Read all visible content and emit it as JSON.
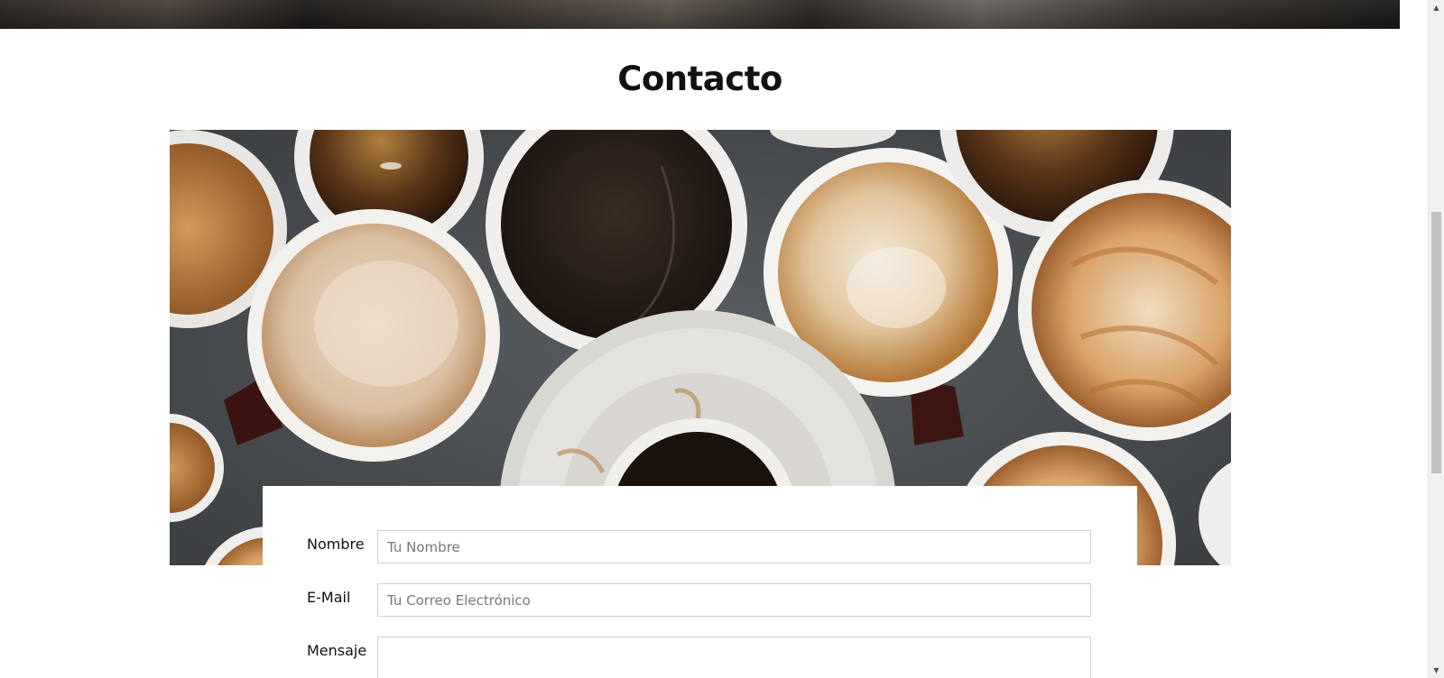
{
  "page": {
    "section_title": "Contacto"
  },
  "photo": {
    "alt": "Tazas de café vistas desde arriba"
  },
  "form": {
    "fields": [
      {
        "label": "Nombre",
        "placeholder": "Tu Nombre",
        "value": ""
      },
      {
        "label": "E-Mail",
        "placeholder": "Tu Correo Electrónico",
        "value": ""
      },
      {
        "label": "Mensaje",
        "placeholder": "",
        "value": ""
      }
    ]
  },
  "scrollbar": {
    "up_icon": "triangle-up",
    "down_icon": "triangle-down"
  },
  "colors": {
    "background": "#ffffff",
    "title": "#111111",
    "input_border": "#cfcfcf",
    "table_surface": "#4b4f52"
  }
}
